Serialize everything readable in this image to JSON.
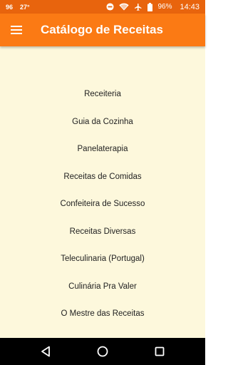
{
  "status_bar": {
    "left_indicators": [
      "96",
      "27°"
    ],
    "battery": "96%",
    "time": "14:43",
    "icons": [
      "minus-circle-icon",
      "wifi-icon",
      "airplane-icon",
      "battery-icon"
    ]
  },
  "app_bar": {
    "title": "Catálogo de Receitas",
    "menu_icon": "hamburger-menu-icon"
  },
  "menu": {
    "items": [
      "Receiteria",
      "Guia da Cozinha",
      "Panelaterapia",
      "Receitas de Comidas",
      "Confeiteira de Sucesso",
      "Receitas Diversas",
      "Teleculinaria (Portugal)",
      "Culinária Pra Valer",
      "O Mestre das Receitas"
    ]
  },
  "nav_bar": {
    "icons": [
      "back-icon",
      "home-icon",
      "recents-icon"
    ]
  },
  "colors": {
    "status_bar": "#e8640d",
    "app_bar": "#fb7a14",
    "background": "#fdf8dc",
    "text": "#222222",
    "nav_bar": "#000000"
  }
}
